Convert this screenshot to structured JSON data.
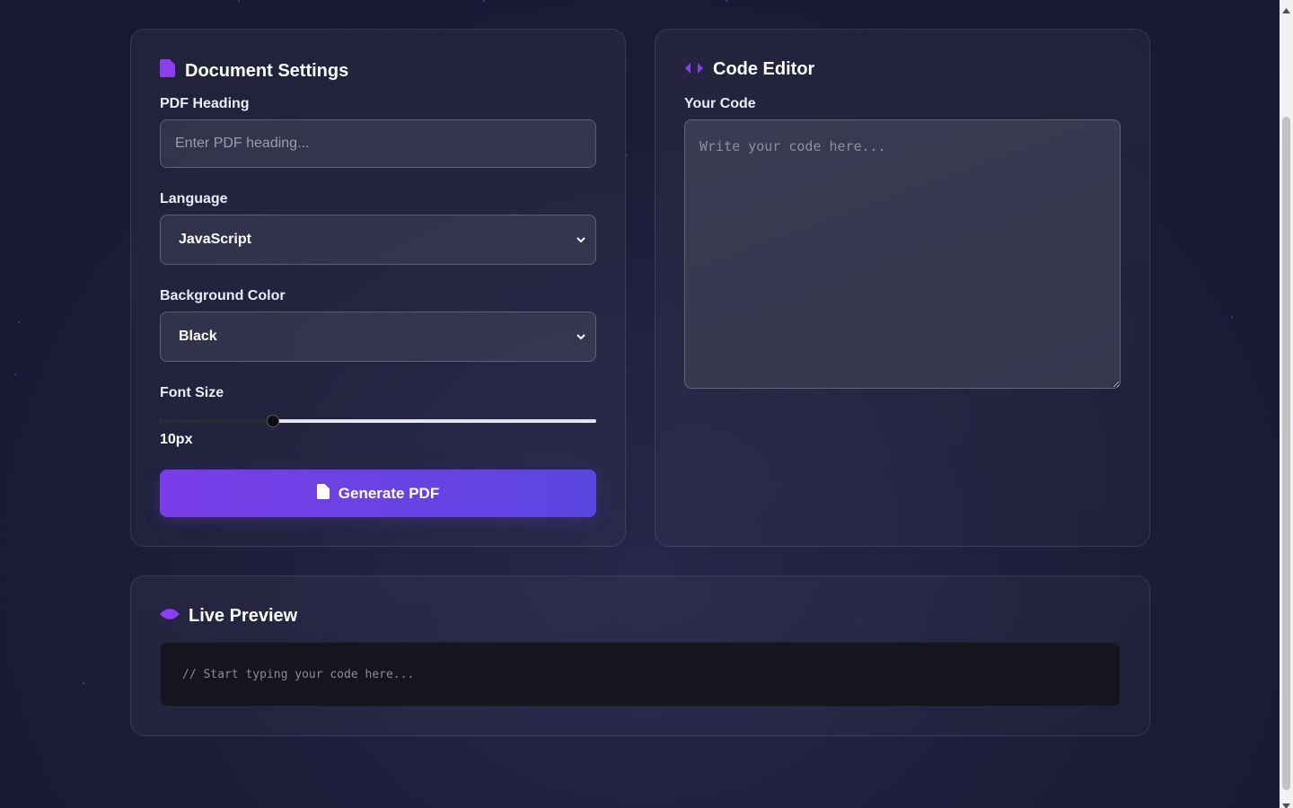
{
  "settings": {
    "title": "Document Settings",
    "heading_label": "PDF Heading",
    "heading_value": "",
    "heading_placeholder": "Enter PDF heading...",
    "language_label": "Language",
    "language_selected": "JavaScript",
    "background_label": "Background Color",
    "background_selected": "Black",
    "font_size_label": "Font Size",
    "font_size_value": "10px",
    "font_size_fraction": 0.26,
    "generate_label": "Generate PDF"
  },
  "editor": {
    "title": "Code Editor",
    "code_label": "Your Code",
    "code_value": "",
    "code_placeholder": "Write your code here..."
  },
  "preview": {
    "title": "Live Preview",
    "content": "// Start typing your code here..."
  },
  "icons": {
    "settings_icon": "document-icon",
    "editor_icon": "code-brackets-icon",
    "preview_icon": "eye-icon",
    "button_icon": "document-icon"
  },
  "colors": {
    "accent": "#8b3df0",
    "button_start": "#7a3ee8",
    "button_end": "#5b46e0",
    "background": "#1c1c38"
  }
}
